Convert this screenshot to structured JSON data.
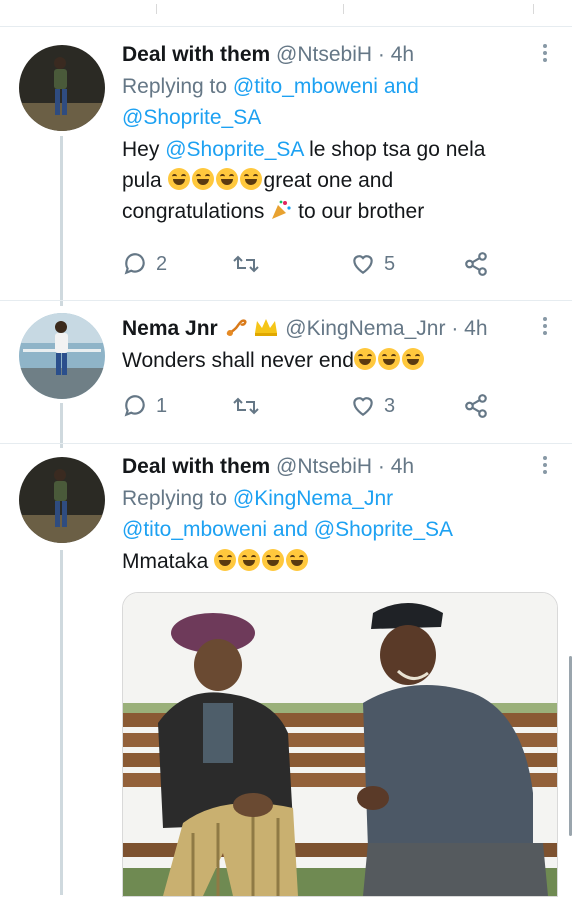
{
  "tweets": [
    {
      "name": "Deal with them",
      "handle": "@NtsebiH",
      "time": "4h",
      "replying_label": "Replying to",
      "replying_to": "@tito_mboweni",
      "replying_and": "and",
      "replying_to_2": "@Shoprite_SA",
      "body_mention": "@Shoprite_SA",
      "body_1": "Hey",
      "body_2": "le shop tsa go nela",
      "body_3": "pula",
      "body_4": "great one and",
      "body_5": "congratulations",
      "body_6": "to our brother",
      "replies": "2",
      "likes": "5"
    },
    {
      "name": "Nema Jnr",
      "handle": "@KingNema_Jnr",
      "time": "4h",
      "body": "Wonders shall never end",
      "replies": "1",
      "likes": "3"
    },
    {
      "name": "Deal with them",
      "handle": "@NtsebiH",
      "time": "4h",
      "replying_label": "Replying to",
      "replying_to": "@KingNema_Jnr",
      "replying_to_2": "@tito_mboweni",
      "replying_and": "and",
      "replying_to_3": "@Shoprite_SA",
      "body": "Mmataka"
    }
  ],
  "icons": {
    "reply": "reply-icon",
    "retweet": "retweet-icon",
    "like": "heart-icon",
    "share": "share-icon",
    "more": "more-vertical-icon"
  },
  "colors": {
    "link": "#1da1f2",
    "muted": "#657786",
    "divider": "#e6ecf0"
  }
}
